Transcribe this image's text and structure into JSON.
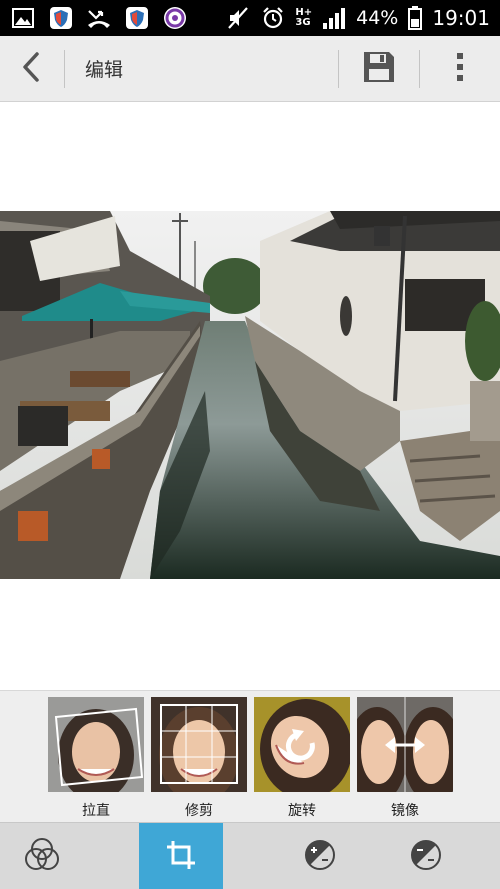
{
  "status_bar": {
    "network_label": "H+",
    "network_sub": "3G",
    "battery": "44%",
    "time": "19:01"
  },
  "app_bar": {
    "title": "编辑"
  },
  "tools": [
    {
      "label": "拉直",
      "icon": "straighten-icon"
    },
    {
      "label": "修剪",
      "icon": "crop-grid-icon"
    },
    {
      "label": "旋转",
      "icon": "rotate-icon"
    },
    {
      "label": "镜像",
      "icon": "mirror-icon"
    }
  ],
  "bottom_nav": {
    "active": "crop",
    "items": [
      "filters",
      "crop",
      "exposure",
      "exposure-alt"
    ]
  },
  "colors": {
    "accent": "#3fa7d6",
    "app_bar_bg": "#ececec",
    "tools_bg": "#eeeeee",
    "bottom_bar_bg": "#d9d9d9"
  }
}
